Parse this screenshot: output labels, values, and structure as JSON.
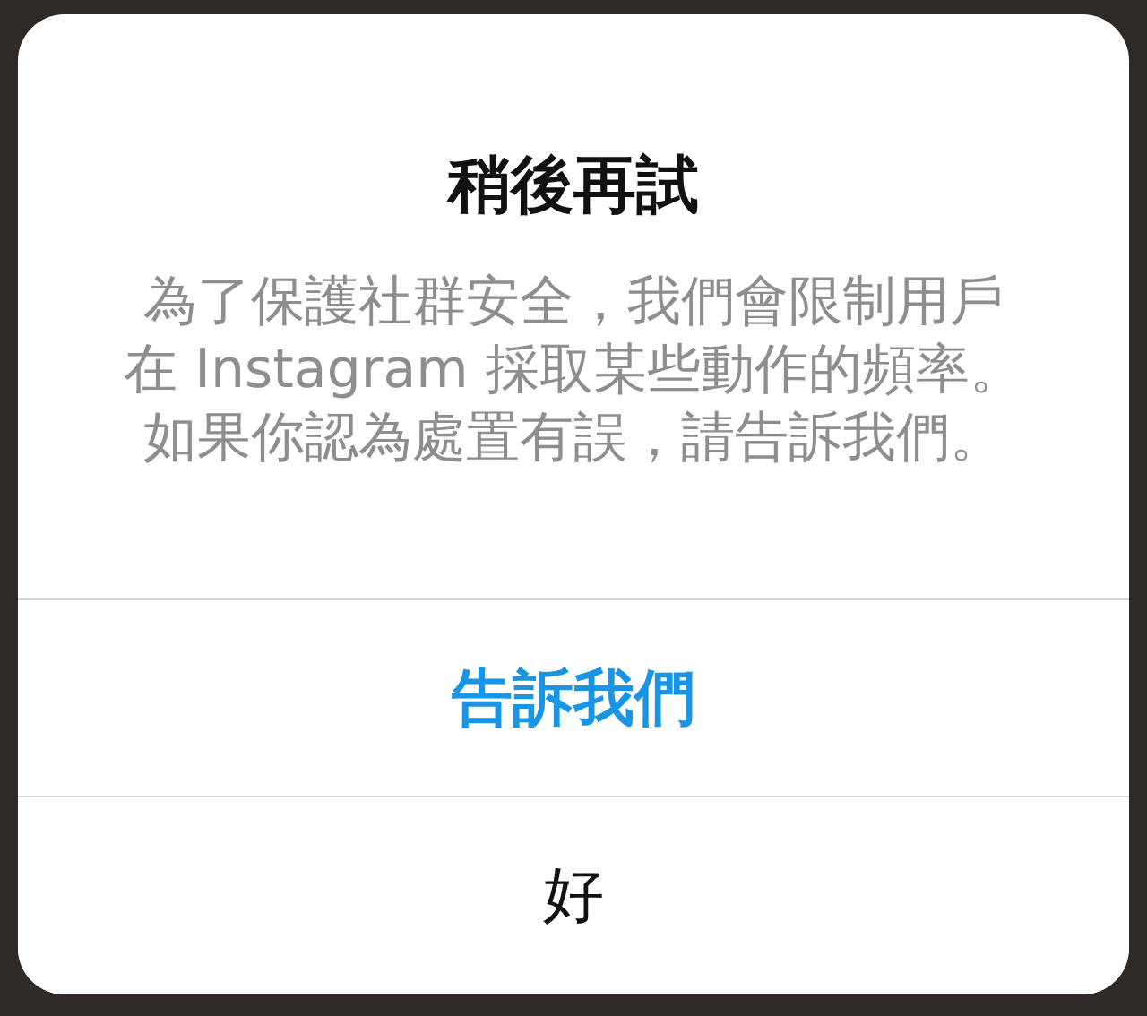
{
  "dialog": {
    "title": "稍後再試",
    "message": "為了保護社群安全，我們會限制用戶在 Instagram 採取某些動作的頻率。如果你認為處置有誤，請告訴我們。",
    "buttons": [
      {
        "label": "告訴我們",
        "kind": "primary"
      },
      {
        "label": "好",
        "kind": "plain"
      }
    ]
  }
}
